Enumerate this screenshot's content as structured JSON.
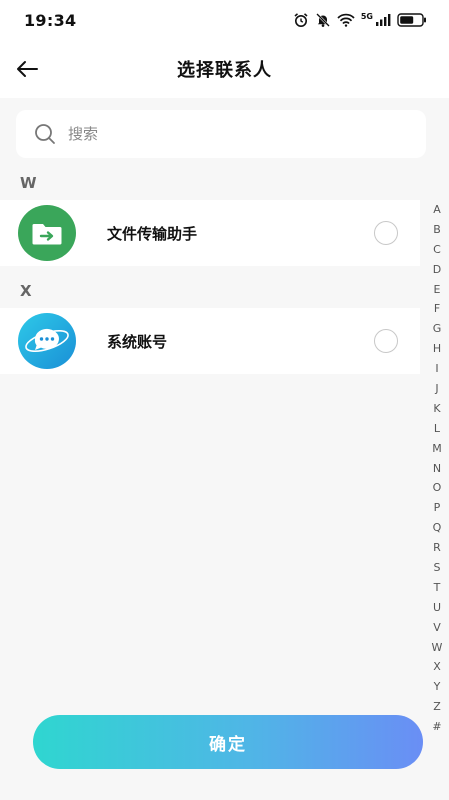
{
  "status": {
    "time": "19:34",
    "network": "5G"
  },
  "header": {
    "title": "选择联系人"
  },
  "search": {
    "placeholder": "搜索"
  },
  "sections": [
    {
      "letter": "W",
      "contacts": [
        {
          "name": "文件传输助手",
          "avatar_icon": "folder-transfer-icon"
        }
      ]
    },
    {
      "letter": "X",
      "contacts": [
        {
          "name": "系统账号",
          "avatar_icon": "chat-bubble-planet-icon"
        }
      ]
    }
  ],
  "alphabet": [
    "A",
    "B",
    "C",
    "D",
    "E",
    "F",
    "G",
    "H",
    "I",
    "J",
    "K",
    "L",
    "M",
    "N",
    "O",
    "P",
    "Q",
    "R",
    "S",
    "T",
    "U",
    "V",
    "W",
    "X",
    "Y",
    "Z",
    "#"
  ],
  "confirm_label": "确定",
  "colors": {
    "file_helper_green": "#3aa65a",
    "button_start": "#2fd6d0",
    "button_end": "#6a8ef5"
  }
}
